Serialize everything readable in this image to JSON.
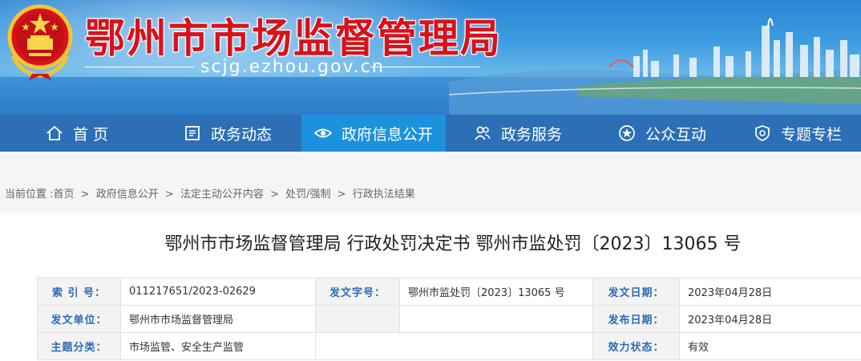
{
  "header": {
    "site_title": "鄂州市市场监督管理局",
    "site_url": "scjg.ezhou.gov.cn",
    "title_color": "#d8121a"
  },
  "nav": {
    "items": [
      {
        "label": "首 页",
        "icon": "home-icon"
      },
      {
        "label": "政务动态",
        "icon": "news-icon"
      },
      {
        "label": "政府信息公开",
        "icon": "eye-icon",
        "active": true
      },
      {
        "label": "政务服务",
        "icon": "people-icon"
      },
      {
        "label": "公众互动",
        "icon": "star-icon"
      },
      {
        "label": "专题专栏",
        "icon": "badge-icon"
      }
    ],
    "bg_color": "#2c6fb6",
    "active_color": "#1c92de"
  },
  "breadcrumb": {
    "prefix": "当前位置 :",
    "items": [
      "首页",
      "政府信息公开",
      "法定主动公开内容",
      "处罚/强制",
      "行政执法结果"
    ],
    "separator": ">"
  },
  "article": {
    "title": "鄂州市市场监督管理局 行政处罚决定书 鄂州市监处罚〔2023〕13065 号"
  },
  "meta": {
    "index_label": "索 引 号：",
    "index_value": "011217651/2023-02629",
    "doc_no_label": "发文字号：",
    "doc_no_value": "鄂州市监处罚〔2023〕13065 号",
    "issue_date_label": "发文日期：",
    "issue_date_value": "2023年04月28日",
    "unit_label": "发文单位：",
    "unit_value": "鄂州市市场监督管理局",
    "publish_date_label": "发布日期：",
    "publish_date_value": "2023年04月28日",
    "topic_label": "主题分类：",
    "topic_value": "市场监管、安全生产监管",
    "status_label": "效力状态：",
    "status_value": "有效",
    "label_color": "#2b6bb5"
  }
}
